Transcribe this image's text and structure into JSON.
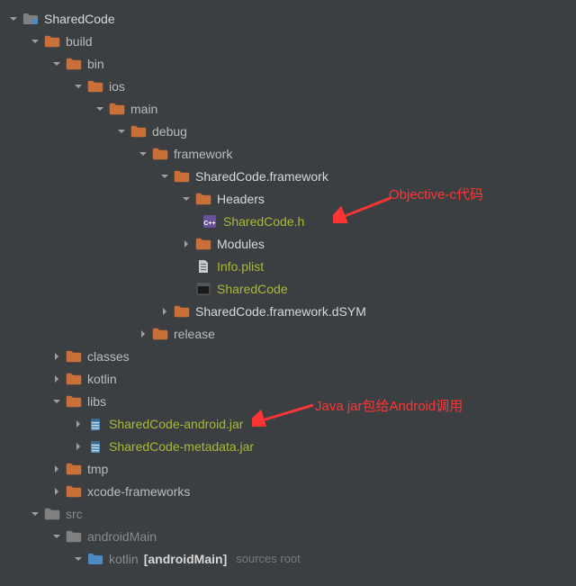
{
  "annotations": {
    "objc": "Objective-c代码",
    "jar": "Java jar包给Android调用"
  },
  "tree": [
    {
      "depth": 0,
      "arrow": "down",
      "icon": "folder-module",
      "label": "SharedCode",
      "cls": "white"
    },
    {
      "depth": 1,
      "arrow": "down",
      "icon": "folder-orange",
      "label": "build"
    },
    {
      "depth": 2,
      "arrow": "down",
      "icon": "folder-orange",
      "label": "bin"
    },
    {
      "depth": 3,
      "arrow": "down",
      "icon": "folder-orange",
      "label": "ios"
    },
    {
      "depth": 4,
      "arrow": "down",
      "icon": "folder-orange",
      "label": "main"
    },
    {
      "depth": 5,
      "arrow": "down",
      "icon": "folder-orange",
      "label": "debug"
    },
    {
      "depth": 6,
      "arrow": "down",
      "icon": "folder-orange",
      "label": "framework"
    },
    {
      "depth": 7,
      "arrow": "down",
      "icon": "folder-orange",
      "label": "SharedCode.framework",
      "cls": "white"
    },
    {
      "depth": 8,
      "arrow": "down",
      "icon": "folder-orange",
      "label": "Headers",
      "cls": "white"
    },
    {
      "depth": 9,
      "arrow": "none",
      "icon": "cpp",
      "label": "SharedCode.h",
      "cls": "green"
    },
    {
      "depth": 8,
      "arrow": "right",
      "icon": "folder-orange",
      "label": "Modules",
      "cls": "white"
    },
    {
      "depth": 8,
      "arrow": "none-pad",
      "icon": "plist",
      "label": "Info.plist",
      "cls": "green"
    },
    {
      "depth": 8,
      "arrow": "none-pad",
      "icon": "exec",
      "label": "SharedCode",
      "cls": "green"
    },
    {
      "depth": 7,
      "arrow": "right",
      "icon": "folder-orange",
      "label": "SharedCode.framework.dSYM",
      "cls": "white"
    },
    {
      "depth": 6,
      "arrow": "right",
      "icon": "folder-orange",
      "label": "release"
    },
    {
      "depth": 2,
      "arrow": "right",
      "icon": "folder-orange",
      "label": "classes"
    },
    {
      "depth": 2,
      "arrow": "right",
      "icon": "folder-orange",
      "label": "kotlin"
    },
    {
      "depth": 2,
      "arrow": "down",
      "icon": "folder-orange",
      "label": "libs"
    },
    {
      "depth": 3,
      "arrow": "right",
      "icon": "jar",
      "label": "SharedCode-android.jar",
      "cls": "green"
    },
    {
      "depth": 3,
      "arrow": "right",
      "icon": "jar",
      "label": "SharedCode-metadata.jar",
      "cls": "green"
    },
    {
      "depth": 2,
      "arrow": "right",
      "icon": "folder-orange",
      "label": "tmp"
    },
    {
      "depth": 2,
      "arrow": "right",
      "icon": "folder-orange",
      "label": "xcode-frameworks"
    },
    {
      "depth": 1,
      "arrow": "down",
      "icon": "folder-gray",
      "label": "src",
      "cls": "gray"
    },
    {
      "depth": 2,
      "arrow": "down",
      "icon": "folder-gray",
      "label": "androidMain",
      "cls": "gray"
    },
    {
      "depth": 3,
      "arrow": "down",
      "icon": "folder-src",
      "label": "kotlin",
      "cls": "gray",
      "suffix": "[androidMain]",
      "hint": "sources root"
    }
  ]
}
